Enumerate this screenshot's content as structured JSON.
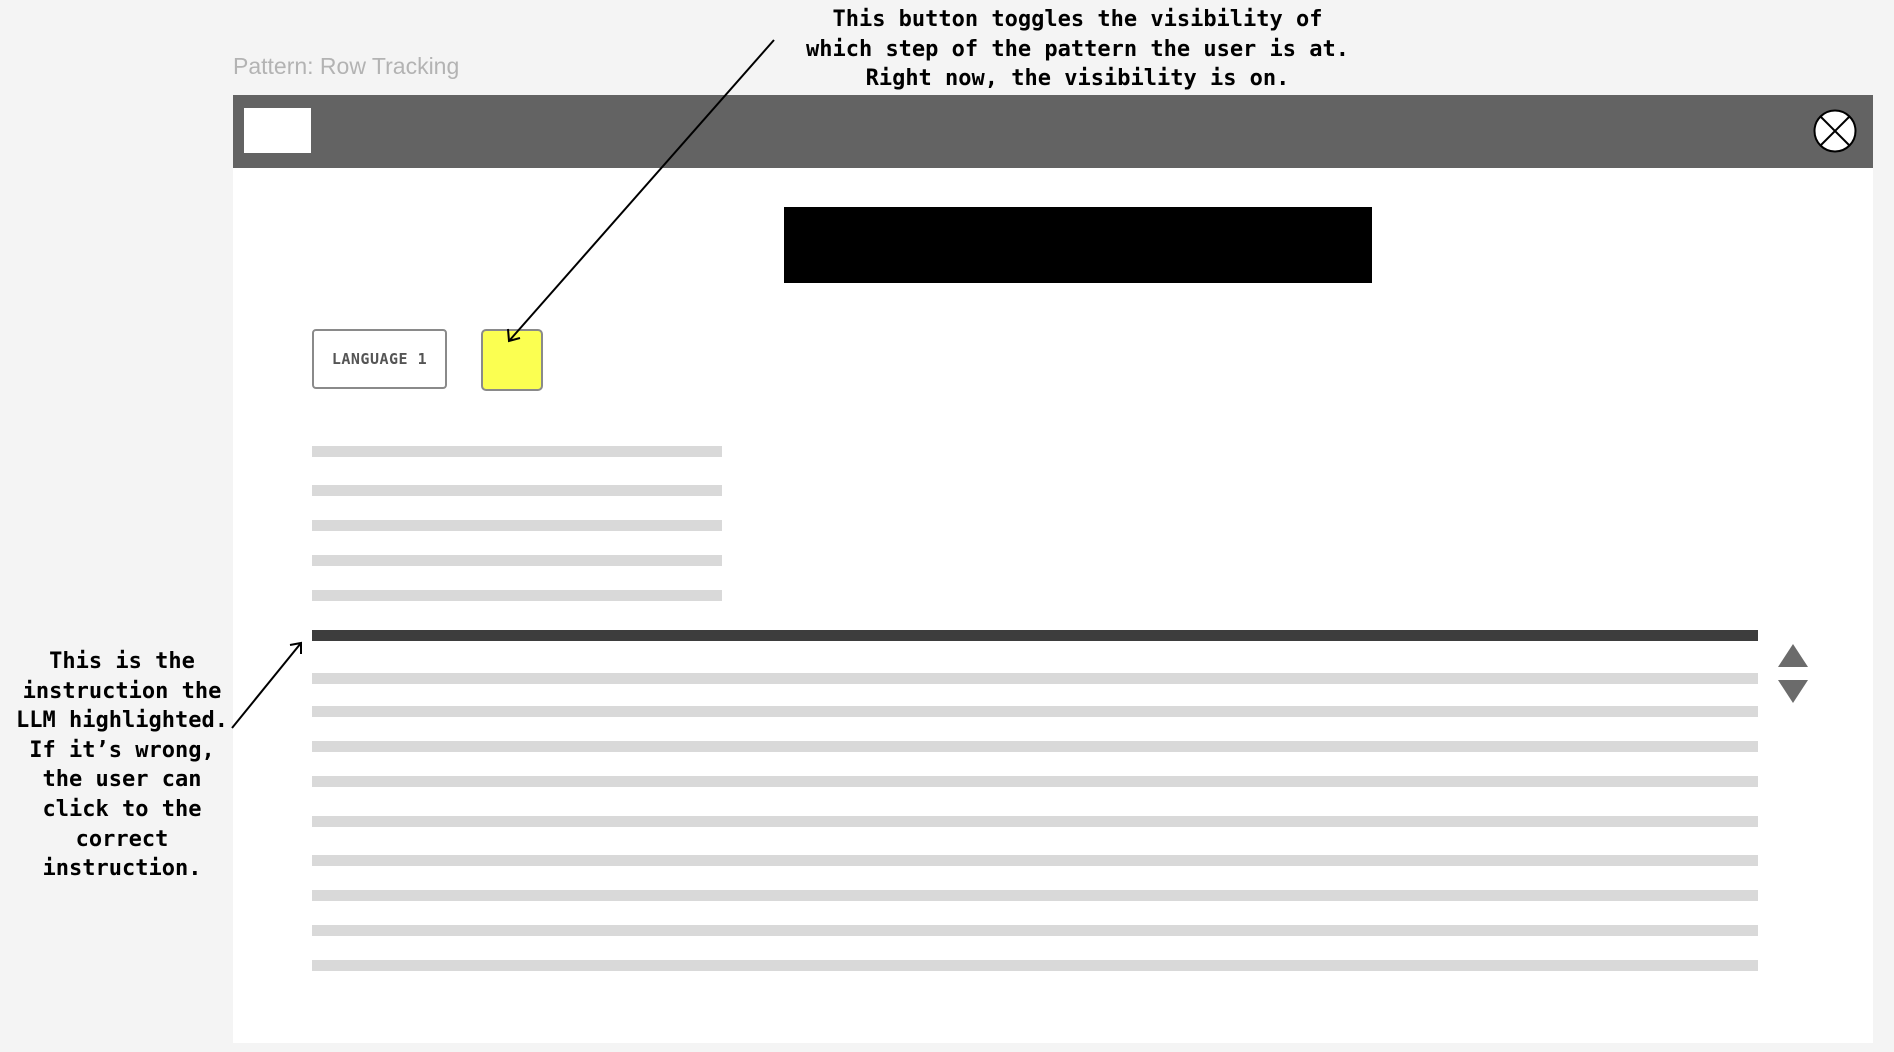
{
  "page": {
    "label": "Pattern: Row Tracking"
  },
  "annotations": {
    "top": "This button toggles the visibility of\nwhich step of the pattern the user is at.\nRight now, the visibility is on.",
    "left": "This is the\ninstruction the\nLLM highlighted.\nIf it’s wrong,\nthe user can\nclick to the\ncorrect\ninstruction."
  },
  "window": {
    "language_button_label": "LANGUAGE 1",
    "row_tracking_toggle": {
      "state": "on",
      "color": "#fbff51"
    },
    "header_color": "#636363",
    "highlighted_instruction_color": "#3d3d3d"
  },
  "icons": {
    "close": "close-circle-x-icon",
    "nav_up": "triangle-up-icon",
    "nav_down": "triangle-down-icon"
  }
}
